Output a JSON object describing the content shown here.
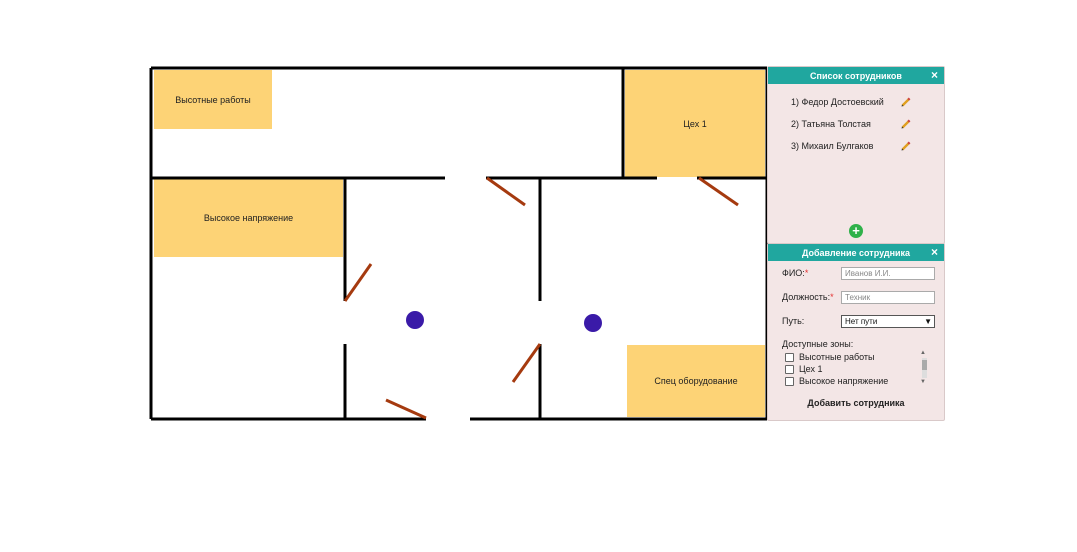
{
  "plan": {
    "zones": {
      "heights_work": "Высотные работы",
      "workshop_1": "Цех 1",
      "high_voltage": "Высокое напряжение",
      "special_equipment": "Спец оборудование"
    },
    "zone_color": "#fdd376",
    "wall_color": "#000000",
    "door_color": "#a53a0f",
    "marker_color": "#3a1aa8"
  },
  "employee_list": {
    "title": "Список сотрудников",
    "close": "×",
    "employees": [
      {
        "label": "1) Федор Достоевский"
      },
      {
        "label": "2) Татьяна Толстая"
      },
      {
        "label": "3) Михаил Булгаков"
      }
    ],
    "edit_icon": "pencil-icon",
    "add_icon": "plus-circle-icon",
    "add_symbol": "+"
  },
  "add_form": {
    "title": "Добавление сотрудника",
    "close": "×",
    "fio_label": "ФИО:",
    "fio_placeholder": "Иванов И.И.",
    "position_label": "Должность:",
    "position_placeholder": "Техник",
    "path_label": "Путь:",
    "path_value": "Нет пути",
    "zones_label": "Доступные зоны:",
    "zones": [
      "Высотные работы",
      "Цех 1",
      "Высокое напряжение"
    ],
    "required_mark": "*",
    "submit": "Добавить сотрудника"
  },
  "colors": {
    "header": "#20a79f",
    "panel_bg": "#f3e6e6",
    "add_button": "#2fb14a"
  }
}
